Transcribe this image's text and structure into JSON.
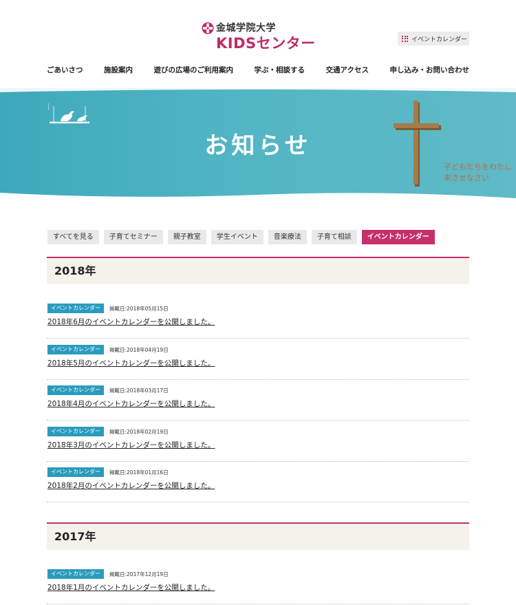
{
  "header": {
    "university": "金城学院大学",
    "site_name": "KIDSセンター",
    "calendar_button": "イベントカレンダー"
  },
  "nav": [
    "ごあいさつ",
    "施設案内",
    "遊びの広場のご利用案内",
    "学ぶ・相談する",
    "交通アクセス",
    "申し込み・お問い合わせ"
  ],
  "hero": {
    "title": "お知らせ",
    "motto_line1": "子どもたちをわたし",
    "motto_line2": "来させなさい"
  },
  "categories": [
    {
      "label": "すべてを見る",
      "active": false
    },
    {
      "label": "子育てセミナー",
      "active": false
    },
    {
      "label": "親子教室",
      "active": false
    },
    {
      "label": "学生イベント",
      "active": false
    },
    {
      "label": "音楽療法",
      "active": false
    },
    {
      "label": "子育て相談",
      "active": false
    },
    {
      "label": "イベントカレンダー",
      "active": true
    }
  ],
  "years": [
    {
      "year": "2018年",
      "posts": [
        {
          "badge": "イベントカレンダー",
          "date": "掲載日:2018年05月15日",
          "title": "2018年6月のイベントカレンダーを公開しました。"
        },
        {
          "badge": "イベントカレンダー",
          "date": "掲載日:2018年04月19日",
          "title": "2018年5月のイベントカレンダーを公開しました。"
        },
        {
          "badge": "イベントカレンダー",
          "date": "掲載日:2018年03月17日",
          "title": "2018年4月のイベントカレンダーを公開しました。"
        },
        {
          "badge": "イベントカレンダー",
          "date": "掲載日:2018年02月19日",
          "title": "2018年3月のイベントカレンダーを公開しました。"
        },
        {
          "badge": "イベントカレンダー",
          "date": "掲載日:2018年01月16日",
          "title": "2018年2月のイベントカレンダーを公開しました。"
        }
      ]
    },
    {
      "year": "2017年",
      "posts": [
        {
          "badge": "イベントカレンダー",
          "date": "掲載日:2017年12月19日",
          "title": "2018年1月のイベントカレンダーを公開しました。"
        }
      ]
    }
  ],
  "colors": {
    "accent": "#c62f6b",
    "badge": "#2a9bbd",
    "hero_teal": "#4fb3c4",
    "year_bg": "#f5f2ec"
  }
}
